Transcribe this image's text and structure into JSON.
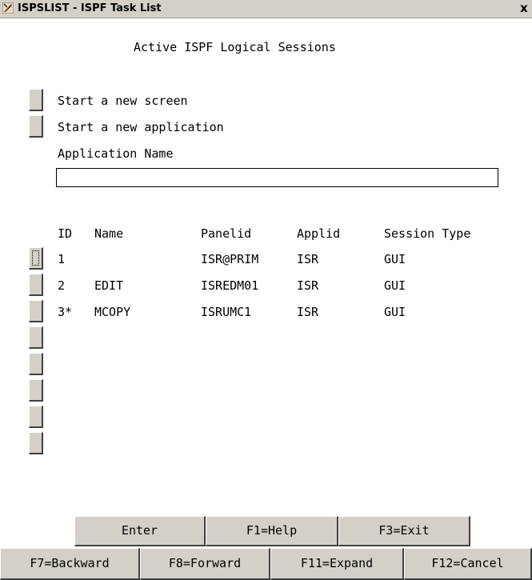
{
  "window": {
    "title": "ISPSLIST - ISPF Task List",
    "close_glyph": "x",
    "icon": "ispf-app-icon"
  },
  "header": {
    "title": "Active ISPF Logical Sessions"
  },
  "actions": {
    "new_screen_label": "Start a new screen",
    "new_application_label": "Start a new application",
    "application_name_label": "Application Name",
    "application_name_value": ""
  },
  "table": {
    "columns": [
      "ID",
      "Name",
      "Panelid",
      "Applid",
      "Session Type"
    ],
    "rows": [
      {
        "id": "1",
        "name": "",
        "panelid": "ISR@PRIM",
        "applid": "ISR",
        "type": "GUI"
      },
      {
        "id": "2",
        "name": "EDIT",
        "panelid": "ISREDM01",
        "applid": "ISR",
        "type": "GUI"
      },
      {
        "id": "3*",
        "name": "MCOPY",
        "panelid": "ISRUMC1",
        "applid": "ISR",
        "type": "GUI"
      }
    ],
    "empty_row_count": 5
  },
  "commands": {
    "enter": "Enter",
    "help": "F1=Help",
    "exit": "F3=Exit"
  },
  "fkeys": {
    "backward": "F7=Backward",
    "forward": "F8=Forward",
    "expand": "F11=Expand",
    "cancel": "F12=Cancel"
  }
}
